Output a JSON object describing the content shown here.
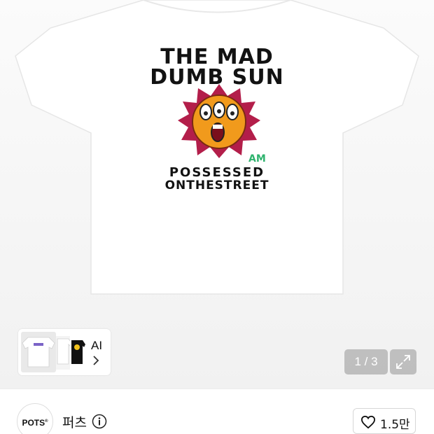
{
  "product_image": {
    "shirt_print": {
      "title_line1": "THE MAD",
      "title_line2": "DUMB SUN",
      "badge": "AM",
      "bottom_line1": "POSSESSED",
      "bottom_line2": "ONTHESTREET"
    }
  },
  "gallery": {
    "thumbnail_label": "AI",
    "page_indicator": "1 / 3"
  },
  "brand": {
    "logo_text": "POTS",
    "logo_mark": "®",
    "name": "퍼츠"
  },
  "like": {
    "count": "1.5만"
  },
  "icons": {
    "chevron": "chevron-right-icon",
    "expand": "expand-icon",
    "info": "info-icon",
    "heart": "heart-icon"
  },
  "colors": {
    "shirt": "#ffffff",
    "sun_rays": "#b31e4a",
    "sun_face": "#f19a1c",
    "badge": "#2fb36e",
    "overlay": "#8f8f8f"
  }
}
